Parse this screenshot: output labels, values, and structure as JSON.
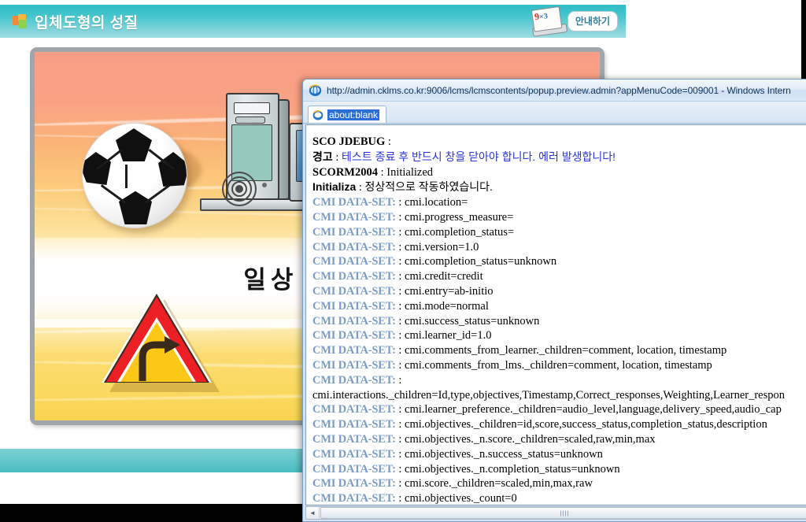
{
  "page": {
    "header": {
      "title": "입체도형의 성질",
      "icon": "blocks-icon",
      "guide_button": {
        "label": "안내하기",
        "note_text": "9",
        "note_sub": "×3",
        "icon": "notepad-icon"
      }
    },
    "scene": {
      "title": "일상 생활어",
      "objects": [
        {
          "name": "soccer-ball",
          "icon": "soccer-ball-icon"
        },
        {
          "name": "desktop-computer",
          "icon": "computer-icon"
        },
        {
          "name": "warning-road-sign",
          "icon": "curve-right-sign-icon"
        }
      ]
    }
  },
  "browser": {
    "window_title": "http://admin.cklms.co.kr:9006/lcms/lcmscontents/popup.preview.admin?appMenuCode=009001  -  Windows Intern",
    "app_icon": "internet-explorer-icon",
    "tab": {
      "label": "about:blank",
      "icon": "internet-explorer-icon"
    },
    "scrollbar": {
      "left_arrow": "◄",
      "right_arrow": "►"
    }
  },
  "log": {
    "lines": [
      {
        "label": "SCO JDEBUG",
        "sep": " :",
        "value": "",
        "style": "bold"
      },
      {
        "label": "경고",
        "sep": " : ",
        "value": "테스트 종료 후 반드시 창을 닫아야 합니다. 에러 발생합니다!",
        "style": "warn"
      },
      {
        "label": "SCORM2004",
        "sep": " : ",
        "value": "Initialized",
        "style": "bold"
      },
      {
        "label": "Initializa",
        "sep": " : ",
        "value": "정상적으로 작동하였습니다.",
        "style": "bold-ko"
      },
      {
        "label": "CMI DATA-SET:",
        "sep": " : ",
        "value": "cmi.location=",
        "style": "ds"
      },
      {
        "label": "CMI DATA-SET:",
        "sep": " : ",
        "value": "cmi.progress_measure=",
        "style": "ds"
      },
      {
        "label": "CMI DATA-SET:",
        "sep": " : ",
        "value": "cmi.completion_status=",
        "style": "ds"
      },
      {
        "label": "CMI DATA-SET:",
        "sep": " : ",
        "value": "cmi.version=1.0",
        "style": "ds"
      },
      {
        "label": "CMI DATA-SET:",
        "sep": " : ",
        "value": "cmi.completion_status=unknown",
        "style": "ds"
      },
      {
        "label": "CMI DATA-SET:",
        "sep": " : ",
        "value": "cmi.credit=credit",
        "style": "ds"
      },
      {
        "label": "CMI DATA-SET:",
        "sep": " : ",
        "value": "cmi.entry=ab-initio",
        "style": "ds"
      },
      {
        "label": "CMI DATA-SET:",
        "sep": " : ",
        "value": "cmi.mode=normal",
        "style": "ds"
      },
      {
        "label": "CMI DATA-SET:",
        "sep": " : ",
        "value": "cmi.success_status=unknown",
        "style": "ds"
      },
      {
        "label": "CMI DATA-SET:",
        "sep": " : ",
        "value": "cmi.learner_id=1.0",
        "style": "ds"
      },
      {
        "label": "CMI DATA-SET:",
        "sep": " : ",
        "value": "cmi.comments_from_learner._children=comment, location, timestamp",
        "style": "ds"
      },
      {
        "label": "CMI DATA-SET:",
        "sep": " : ",
        "value": "cmi.comments_from_lms._children=comment, location, timestamp",
        "style": "ds"
      },
      {
        "label": "CMI DATA-SET:",
        "sep": " :",
        "value": "",
        "style": "ds"
      },
      {
        "label": "",
        "sep": "",
        "value": "cmi.interactions._children=Id,type,objectives,Timestamp,Correct_responses,Weighting,Learner_respon",
        "style": "plain"
      },
      {
        "label": "CMI DATA-SET:",
        "sep": " : ",
        "value": "cmi.learner_preference._children=audio_level,language,delivery_speed,audio_cap",
        "style": "ds"
      },
      {
        "label": "CMI DATA-SET:",
        "sep": " : ",
        "value": "cmi.objectives._children=id,score,success_status,completion_status,description",
        "style": "ds"
      },
      {
        "label": "CMI DATA-SET:",
        "sep": " : ",
        "value": "cmi.objectives._n.score._children=scaled,raw,min,max",
        "style": "ds"
      },
      {
        "label": "CMI DATA-SET:",
        "sep": " : ",
        "value": "cmi.objectives._n.success_status=unknown",
        "style": "ds"
      },
      {
        "label": "CMI DATA-SET:",
        "sep": " : ",
        "value": "cmi.objectives._n.completion_status=unknown",
        "style": "ds"
      },
      {
        "label": "CMI DATA-SET:",
        "sep": " : ",
        "value": "cmi.score._children=scaled,min,max,raw",
        "style": "ds"
      },
      {
        "label": "CMI DATA-SET:",
        "sep": " : ",
        "value": "cmi.objectives._count=0",
        "style": "ds"
      }
    ]
  },
  "colors": {
    "header_teal": "#46c5cd",
    "log_label_blue": "#7a9cc6",
    "warn_blue": "#2735d6",
    "sign_red": "#ec2024",
    "sign_yellow": "#fbc818"
  }
}
